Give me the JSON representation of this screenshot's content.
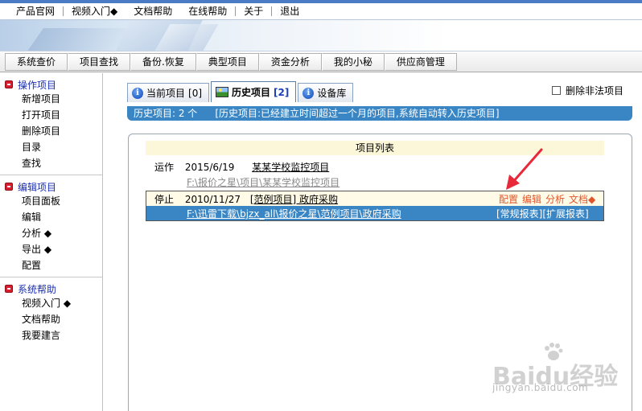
{
  "top_menu": [
    "产品官网",
    "视频入门◆",
    "文档帮助",
    "在线帮助",
    "关于",
    "退出"
  ],
  "toolbar": [
    "系统查价",
    "项目查找",
    "备份.恢复",
    "典型项目",
    "资金分析",
    "我的小秘",
    "供应商管理"
  ],
  "sidebar": {
    "groups": [
      {
        "title": "操作项目",
        "items": [
          "新增项目",
          "打开项目",
          "删除项目",
          "目录",
          "查找"
        ]
      },
      {
        "title": "编辑项目",
        "items": [
          "项目面板",
          "编辑",
          "分析 ◆",
          "导出 ◆",
          "配置"
        ]
      },
      {
        "title": "系统帮助",
        "items": [
          "视频入门 ◆",
          "文档帮助",
          "我要建言"
        ]
      }
    ]
  },
  "tabs": [
    {
      "label": "当前项目",
      "count": "[0]",
      "icon": "info-icon"
    },
    {
      "label": "历史项目",
      "count": "[2]",
      "icon": "image-icon"
    },
    {
      "label": "设备库",
      "count": "",
      "icon": "info-icon"
    }
  ],
  "delete_illegal": "删除非法项目",
  "status": {
    "count_text": "历史项目: 2 个",
    "note": "[历史项目:已经建立时间超过一个月的项目,系统自动转入历史项目]"
  },
  "list": {
    "header": "项目列表",
    "rows": [
      {
        "status": "运作",
        "date": "2015/6/19",
        "name": "某某学校监控项目",
        "path": "F:\\报价之星\\项目\\某某学校监控项目"
      },
      {
        "status": "停止",
        "date": "2010/11/27",
        "name": "[范例项目] 政府采购",
        "path": "F:\\迅雷下载\\bjzx_all\\报价之星\\范例项目\\政府采购"
      }
    ],
    "actions": [
      "配置",
      "编辑",
      "分析",
      "文档◆"
    ],
    "reports": [
      "[常规报表]",
      "[扩展报表]"
    ]
  },
  "colors": {
    "accent_blue": "#3a86c4",
    "group_title": "#1a2fb0",
    "action_orange": "#e2552b",
    "arrow_red": "#e8293a"
  },
  "watermark": {
    "logo": "Baidu经验",
    "url": "jingyan.baidu.com"
  }
}
